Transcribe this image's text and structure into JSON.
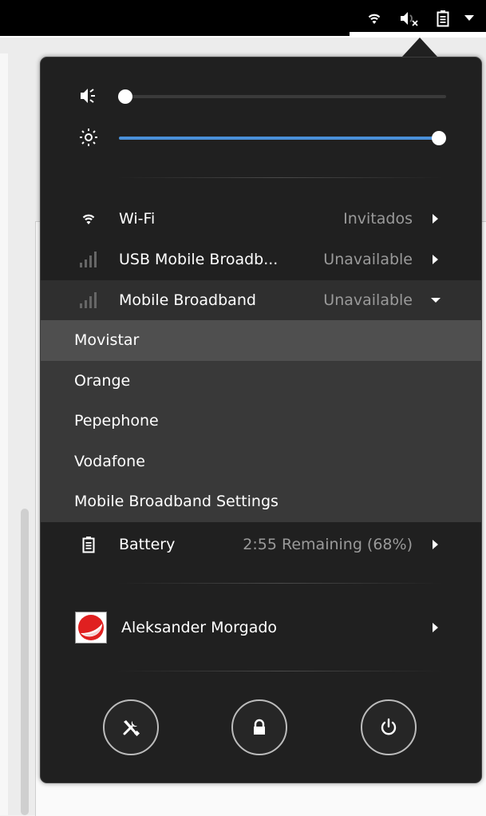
{
  "panel": {
    "icons": [
      "wifi-icon",
      "volume-muted-icon",
      "battery-icon",
      "dropdown-arrow-icon"
    ]
  },
  "volume": {
    "icon": "volume-icon",
    "level": 0.0
  },
  "brightness": {
    "icon": "brightness-icon",
    "level": 1.0
  },
  "network": {
    "wifi": {
      "label": "Wi-Fi",
      "value": "Invitados",
      "icon": "wifi-icon"
    },
    "usb_broadband": {
      "label": "USB Mobile Broadb...",
      "value": "Unavailable",
      "icon": "signal-bars-icon"
    },
    "mobile_broadband": {
      "label": "Mobile Broadband",
      "value": "Unavailable",
      "icon": "signal-bars-icon"
    }
  },
  "mobile_submenu": {
    "items": [
      {
        "label": "Movistar"
      },
      {
        "label": "Orange"
      },
      {
        "label": "Pepephone"
      },
      {
        "label": "Vodafone"
      },
      {
        "label": "Mobile Broadband Settings"
      }
    ]
  },
  "battery": {
    "label": "Battery",
    "value": "2:55 Remaining (68%)",
    "icon": "battery-icon"
  },
  "user": {
    "name": "Aleksander Morgado",
    "icon": "avatar"
  },
  "actions": {
    "settings": "settings-tools-icon",
    "lock": "lock-icon",
    "power": "power-icon"
  },
  "colors": {
    "menu_bg": "#202020",
    "submenu_bg": "#393939",
    "highlight": "#4f4f4f",
    "accent": "#4a90d9",
    "muted_text": "#9a9a9a"
  }
}
